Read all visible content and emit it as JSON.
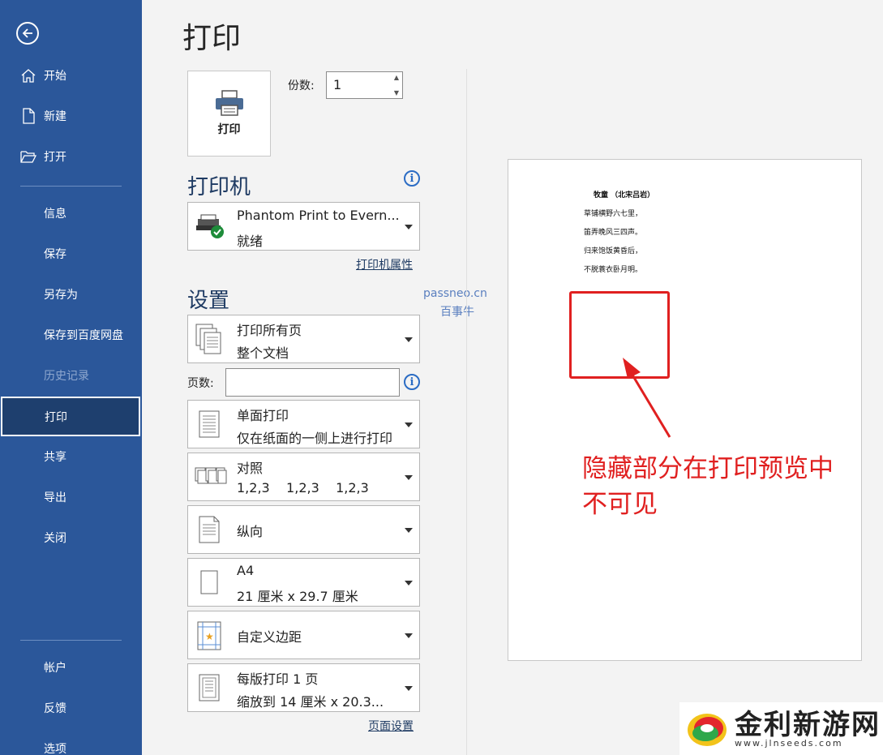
{
  "sidebar": {
    "items": [
      {
        "label": "开始",
        "icon": "home-icon"
      },
      {
        "label": "新建",
        "icon": "new-document-icon"
      },
      {
        "label": "打开",
        "icon": "open-folder-icon"
      },
      {
        "label": "信息"
      },
      {
        "label": "保存"
      },
      {
        "label": "另存为"
      },
      {
        "label": "保存到百度网盘"
      },
      {
        "label": "历史记录",
        "disabled": true
      },
      {
        "label": "打印",
        "active": true
      },
      {
        "label": "共享"
      },
      {
        "label": "导出"
      },
      {
        "label": "关闭"
      },
      {
        "label": "帐户"
      },
      {
        "label": "反馈"
      },
      {
        "label": "选项"
      }
    ],
    "color": "#2b579a"
  },
  "main": {
    "title": "打印",
    "print_button": "打印",
    "copies_label": "份数:",
    "copies_value": "1",
    "printer_heading": "打印机",
    "printer_name": "Phantom Print to Evern...",
    "printer_status": "就绪",
    "printer_properties_link": "打印机属性",
    "settings_heading": "设置",
    "pages_label": "页数:",
    "page_setup_link": "页面设置",
    "settings": [
      {
        "line1": "打印所有页",
        "line2": "整个文档"
      },
      {
        "line1": "单面打印",
        "line2": "仅在纸面的一侧上进行打印"
      },
      {
        "line1": "对照",
        "line2": "1,2,3    1,2,3    1,2,3"
      },
      {
        "line1": "纵向"
      },
      {
        "line1": "A4",
        "line2": "21 厘米 x 29.7 厘米"
      },
      {
        "line1": "自定义边距"
      },
      {
        "line1": "每版打印 1 页",
        "line2": "缩放到 14 厘米 x 20.3..."
      }
    ]
  },
  "watermark": {
    "line1": "passneo.cn",
    "line2": "百事牛"
  },
  "preview": {
    "poem_title": "牧童  （北宋吕岩）",
    "poem_lines": [
      "草铺横野六七里，",
      "笛弄晚风三四声。",
      "归来饱饭黄昏后，",
      "不脱蓑衣卧月明。"
    ],
    "annotation_line1": "隐藏部分在打印预览中",
    "annotation_line2": "不可见",
    "annotation_color": "#e02020"
  },
  "logo": {
    "text": "金利新游网",
    "url": "www.jlnseeds.com"
  }
}
